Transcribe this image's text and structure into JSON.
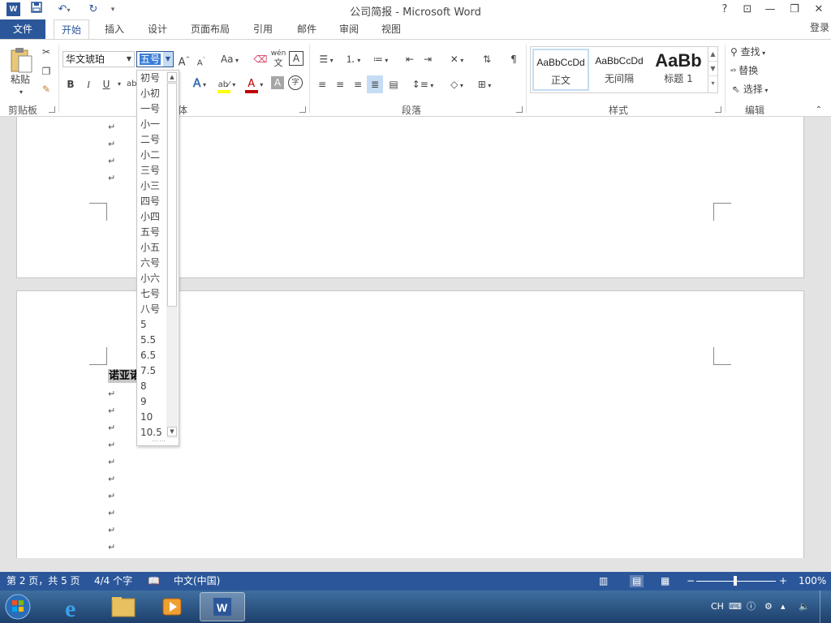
{
  "app": {
    "title": "公司简报 - Microsoft Word",
    "logo_letter": "W",
    "login": "登录"
  },
  "window_controls": {
    "help": "?",
    "ribbon_display": "⊡",
    "minimize": "—",
    "restore": "❐",
    "close": "✕"
  },
  "tabs": [
    {
      "label": "文件"
    },
    {
      "label": "开始"
    },
    {
      "label": "插入"
    },
    {
      "label": "设计"
    },
    {
      "label": "页面布局"
    },
    {
      "label": "引用"
    },
    {
      "label": "邮件"
    },
    {
      "label": "审阅"
    },
    {
      "label": "视图"
    }
  ],
  "ribbon": {
    "clipboard": {
      "label": "剪贴板",
      "paste": "粘贴"
    },
    "font": {
      "label": "字体",
      "label_visible": "体",
      "font_name": "华文琥珀",
      "font_size": "五号",
      "bold": "B",
      "italic": "I",
      "underline": "U",
      "grow": "A",
      "shrink": "A",
      "case": "Aa",
      "phonetic": "wén",
      "phonetic_char": "文",
      "border_char": "A",
      "text_effects": "A",
      "font_color": "A",
      "char_shade": "A",
      "enclose": "字"
    },
    "paragraph": {
      "label": "段落"
    },
    "styles": {
      "label": "样式",
      "items": [
        {
          "sample": "AaBbCcDd",
          "name": "正文"
        },
        {
          "sample": "AaBbCcDd",
          "name": "无间隔"
        },
        {
          "sample": "AaBb",
          "name": "标题 1"
        }
      ]
    },
    "editing": {
      "label": "编辑",
      "find": "查找",
      "replace": "替换",
      "select": "选择"
    }
  },
  "font_size_menu": {
    "options": [
      "初号",
      "小初",
      "一号",
      "小一",
      "二号",
      "小二",
      "三号",
      "小三",
      "四号",
      "小四",
      "五号",
      "小五",
      "六号",
      "小六",
      "七号",
      "八号",
      "5",
      "5.5",
      "6.5",
      "7.5",
      "8",
      "9",
      "10",
      "10.5"
    ]
  },
  "document": {
    "paragraph_mark": "↵",
    "selected_text": "诺亚诺"
  },
  "status_bar": {
    "page": "第 2 页，共 5 页",
    "words": "4/4 个字",
    "language": "中文(中国)",
    "zoom": "100%"
  },
  "tray": {
    "ime": "CH"
  },
  "colors": {
    "accent": "#2b579a",
    "highlight": "#ffff00",
    "font_color": "#c00000"
  }
}
